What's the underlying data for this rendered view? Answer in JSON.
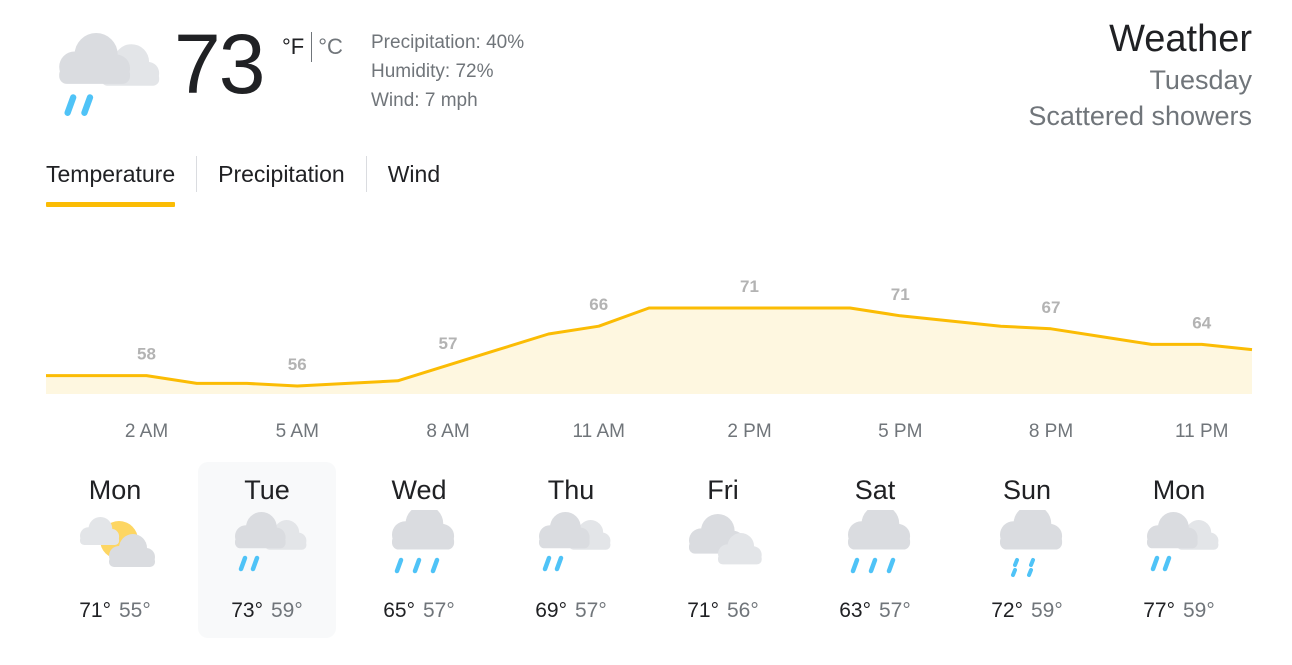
{
  "current": {
    "temperature": "73",
    "unit_f": "°F",
    "unit_c": "°C",
    "precipitation": "Precipitation: 40%",
    "humidity": "Humidity: 72%",
    "wind": "Wind: 7 mph",
    "icon": "scattered-showers-icon"
  },
  "header": {
    "title": "Weather",
    "day": "Tuesday",
    "condition": "Scattered showers"
  },
  "tabs": [
    {
      "label": "Temperature",
      "active": true
    },
    {
      "label": "Precipitation",
      "active": false
    },
    {
      "label": "Wind",
      "active": false
    }
  ],
  "colors": {
    "accent": "#fbbc04",
    "chart_fill": "#fef7e0",
    "rain": "#4fc3f7",
    "cloud": "#dadce0",
    "sun": "#fdd663"
  },
  "chart_data": {
    "type": "area",
    "x": [
      "12 AM",
      "1 AM",
      "2 AM",
      "3 AM",
      "4 AM",
      "5 AM",
      "6 AM",
      "7 AM",
      "8 AM",
      "9 AM",
      "10 AM",
      "11 AM",
      "12 PM",
      "1 PM",
      "2 PM",
      "3 PM",
      "4 PM",
      "5 PM",
      "6 PM",
      "7 PM",
      "8 PM",
      "9 PM",
      "10 PM",
      "11 PM",
      "12 AM"
    ],
    "y": [
      58,
      58,
      58,
      56.5,
      56.5,
      56,
      56.5,
      57,
      60,
      63,
      66,
      67.5,
      71,
      71,
      71,
      71,
      71,
      69.5,
      68.5,
      67.5,
      67,
      65.5,
      64,
      64,
      63
    ],
    "point_labels": [
      {
        "x": "2 AM",
        "value": "58"
      },
      {
        "x": "5 AM",
        "value": "56"
      },
      {
        "x": "8 AM",
        "value": "57"
      },
      {
        "x": "11 AM",
        "value": "66"
      },
      {
        "x": "2 PM",
        "value": "71"
      },
      {
        "x": "5 PM",
        "value": "71"
      },
      {
        "x": "8 PM",
        "value": "67"
      },
      {
        "x": "11 PM",
        "value": "64"
      }
    ],
    "tick_labels": [
      "2 AM",
      "5 AM",
      "8 AM",
      "11 AM",
      "2 PM",
      "5 PM",
      "8 PM",
      "11 PM"
    ],
    "title": "",
    "xlabel": "",
    "ylabel": "",
    "grid": false,
    "legend": "none"
  },
  "days": [
    {
      "name": "Mon",
      "high": "71°",
      "low": "55°",
      "icon": "partly-cloudy-icon",
      "selected": false
    },
    {
      "name": "Tue",
      "high": "73°",
      "low": "59°",
      "icon": "scattered-showers-icon",
      "selected": true
    },
    {
      "name": "Wed",
      "high": "65°",
      "low": "57°",
      "icon": "showers-icon",
      "selected": false
    },
    {
      "name": "Thu",
      "high": "69°",
      "low": "57°",
      "icon": "scattered-showers-icon",
      "selected": false
    },
    {
      "name": "Fri",
      "high": "71°",
      "low": "56°",
      "icon": "cloudy-icon",
      "selected": false
    },
    {
      "name": "Sat",
      "high": "63°",
      "low": "57°",
      "icon": "showers-icon",
      "selected": false
    },
    {
      "name": "Sun",
      "high": "72°",
      "low": "59°",
      "icon": "light-rain-icon",
      "selected": false
    },
    {
      "name": "Mon",
      "high": "77°",
      "low": "59°",
      "icon": "scattered-showers-icon",
      "selected": false
    }
  ]
}
